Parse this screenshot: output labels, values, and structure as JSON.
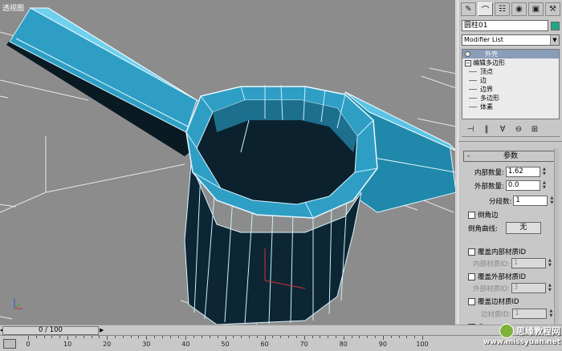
{
  "viewport": {
    "label": "透视图"
  },
  "panel": {
    "tabs": [
      "create-icon",
      "modify-icon",
      "hierarchy-icon",
      "motion-icon",
      "display-icon",
      "utilities-icon"
    ],
    "object_name": "圆柱01",
    "object_color": "#1fa88a",
    "modifier_list": "Modifier List",
    "stack": {
      "top": "外壳",
      "modifier": "编辑多边形",
      "subs": [
        "顶点",
        "边",
        "边界",
        "多边形",
        "体素"
      ]
    },
    "rollout": {
      "title": "参数",
      "inner_amount_label": "内部数量:",
      "inner_amount": "1.62",
      "outer_amount_label": "外部数量:",
      "outer_amount": "0.0",
      "segments_label": "分段数:",
      "segments": "1",
      "bevel_edges_label": "倒角边",
      "bevel_curve_label": "倒角曲线:",
      "bevel_curve_btn": "无",
      "override_inner_label": "覆盖内部材质ID",
      "inner_mat_label": "内部材质ID:",
      "inner_mat": "1",
      "override_outer_label": "覆盖外部材质ID",
      "outer_mat_label": "外部材质ID:",
      "outer_mat": "3",
      "override_edge_label": "覆盖边材质ID",
      "edge_mat_label": "边材质ID:",
      "edge_mat": "1",
      "auto_label": "自"
    }
  },
  "timeline": {
    "slider": "0 / 100",
    "ticks": [
      "0",
      "10",
      "20",
      "30",
      "40",
      "50",
      "60",
      "70",
      "80",
      "90",
      "100"
    ]
  },
  "watermark": {
    "cn": "思缘教程网",
    "url": "www.missyuan.net"
  }
}
